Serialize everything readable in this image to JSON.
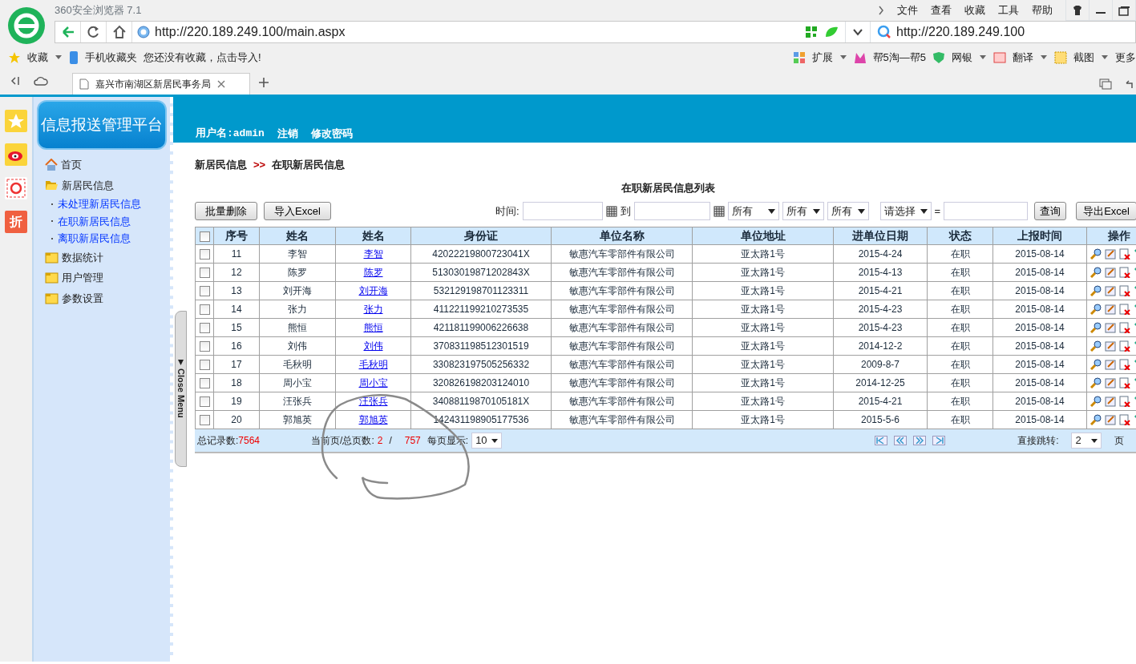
{
  "browser": {
    "title": "360安全浏览器 7.1",
    "menu": [
      "文件",
      "查看",
      "收藏",
      "工具",
      "帮助"
    ],
    "address": "http://220.189.249.100/main.aspx",
    "search": "http://220.189.249.100",
    "bookmarks": [
      "收藏",
      "手机收藏夹",
      "您还没有收藏，点击导入!"
    ],
    "extensions": [
      "扩展",
      "帮5淘—帮5",
      "网银",
      "翻译",
      "截图",
      "更多"
    ],
    "tabs": [
      {
        "label": "嘉兴市南湖区新居民事务局",
        "selected": true
      }
    ],
    "side_apps": [
      "折"
    ]
  },
  "app": {
    "title": "信息报送管理平台",
    "user": "用户名:admin",
    "header_links": [
      "注销",
      "修改密码"
    ],
    "sidebar": [
      {
        "label": "首页",
        "kind": "home"
      },
      {
        "label": "新居民信息",
        "kind": "folder",
        "expanded": true,
        "children": [
          {
            "label": "未处理新居民信息"
          },
          {
            "label": "在职新居民信息"
          },
          {
            "label": "离职新居民信息"
          }
        ]
      },
      {
        "label": "数据统计",
        "kind": "folder",
        "expanded": false
      },
      {
        "label": "用户管理",
        "kind": "folder",
        "expanded": false
      },
      {
        "label": "参数设置",
        "kind": "folder",
        "expanded": false
      }
    ],
    "close_menu": "Close Menu",
    "breadcrumb": [
      "新居民信息",
      "在职新居民信息"
    ],
    "breadcrumb_separator": ">>",
    "table_title": "在职新居民信息列表",
    "toolbar": {
      "buttons": [
        "批量删除",
        "导入Excel"
      ],
      "time_label": "时间:",
      "to_label": "到",
      "selects": [
        "所有",
        "所有",
        "所有",
        "请选择"
      ],
      "equals": "=",
      "query": "查询",
      "export": "导出Excel"
    },
    "table": {
      "header_checked": false,
      "columns": [
        {
          "label": "序号",
          "kind": "text"
        },
        {
          "label": "姓名",
          "kind": "text"
        },
        {
          "label": "姓名",
          "kind": "link"
        },
        {
          "label": "身份证",
          "kind": "text"
        },
        {
          "label": "单位名称",
          "kind": "text"
        },
        {
          "label": "单位地址",
          "kind": "text"
        },
        {
          "label": "进单位日期",
          "kind": "text"
        },
        {
          "label": "状态",
          "kind": "text"
        },
        {
          "label": "上报时间",
          "kind": "text"
        },
        {
          "label": "操作",
          "kind": "actions"
        }
      ],
      "rows": [
        {
          "checked": false,
          "cells": [
            "11",
            "李智",
            "李智",
            "42022219800723041X",
            "敏惠汽车零部件有限公司",
            "亚太路1号",
            "2015-4-24",
            "在职",
            "2015-08-14"
          ]
        },
        {
          "checked": false,
          "cells": [
            "12",
            "陈罗",
            "陈罗",
            "51303019871202843X",
            "敏惠汽车零部件有限公司",
            "亚太路1号",
            "2015-4-13",
            "在职",
            "2015-08-14"
          ]
        },
        {
          "checked": false,
          "cells": [
            "13",
            "刘开海",
            "刘开海",
            "532129198701123311",
            "敏惠汽车零部件有限公司",
            "亚太路1号",
            "2015-4-21",
            "在职",
            "2015-08-14"
          ]
        },
        {
          "checked": false,
          "cells": [
            "14",
            "张力",
            "张力",
            "411221199210273535",
            "敏惠汽车零部件有限公司",
            "亚太路1号",
            "2015-4-23",
            "在职",
            "2015-08-14"
          ]
        },
        {
          "checked": false,
          "cells": [
            "15",
            "熊恒",
            "熊恒",
            "421181199006226638",
            "敏惠汽车零部件有限公司",
            "亚太路1号",
            "2015-4-23",
            "在职",
            "2015-08-14"
          ]
        },
        {
          "checked": false,
          "cells": [
            "16",
            "刘伟",
            "刘伟",
            "370831198512301519",
            "敏惠汽车零部件有限公司",
            "亚太路1号",
            "2014-12-2",
            "在职",
            "2015-08-14"
          ]
        },
        {
          "checked": false,
          "cells": [
            "17",
            "毛秋明",
            "毛秋明",
            "330823197505256332",
            "敏惠汽车零部件有限公司",
            "亚太路1号",
            "2009-8-7",
            "在职",
            "2015-08-14"
          ]
        },
        {
          "checked": false,
          "cells": [
            "18",
            "周小宝",
            "周小宝",
            "320826198203124010",
            "敏惠汽车零部件有限公司",
            "亚太路1号",
            "2014-12-25",
            "在职",
            "2015-08-14"
          ]
        },
        {
          "checked": false,
          "cells": [
            "19",
            "汪张兵",
            "汪张兵",
            "34088119870105181X",
            "敏惠汽车零部件有限公司",
            "亚太路1号",
            "2015-4-21",
            "在职",
            "2015-08-14"
          ]
        },
        {
          "checked": false,
          "cells": [
            "20",
            "郭旭英",
            "郭旭英",
            "142431198905177536",
            "敏惠汽车零部件有限公司",
            "亚太路1号",
            "2015-5-6",
            "在职",
            "2015-08-14"
          ]
        }
      ]
    },
    "footer": {
      "total_label": "总记录数:",
      "total": "7564",
      "page_label": "当前页/总页数:",
      "page": "2",
      "slash": "/",
      "pages": "757",
      "per_page_label": "每页显示:",
      "per_page": "10",
      "jump_label": "直接跳转:",
      "jump": "2",
      "page_unit": "页"
    }
  }
}
